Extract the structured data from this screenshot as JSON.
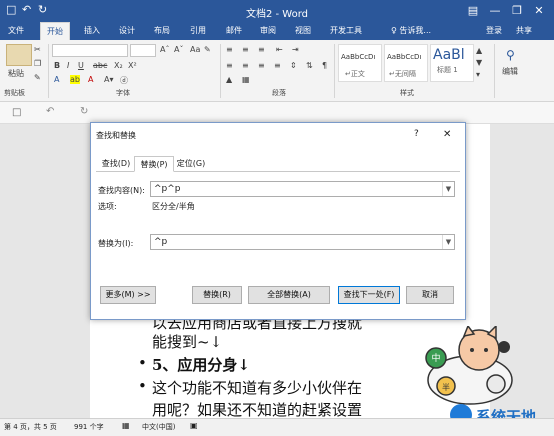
{
  "window": {
    "title": "文档2 - Word",
    "min_icon": "minimize-icon",
    "restore_icon": "restore-icon",
    "close_icon": "close-icon",
    "options_icon": "ribbon-options-icon"
  },
  "ribbon_tabs": [
    "文件",
    "开始",
    "插入",
    "设计",
    "布局",
    "引用",
    "邮件",
    "审阅",
    "视图",
    "开发工具"
  ],
  "tell_me": "♀ 告诉我...",
  "account": {
    "login": "登录",
    "share": "共享"
  },
  "ribbon": {
    "paste": "粘贴",
    "clipboard": "剪贴板",
    "font": "字体",
    "paragraph": "段落",
    "styles": "样式",
    "edit": "编辑",
    "styles_list": [
      {
        "preview": "AaBbCcDı",
        "name": "↵正文"
      },
      {
        "preview": "AaBbCcDı",
        "name": "↵无间隔"
      },
      {
        "preview": "AaBl",
        "name": "标题 1"
      }
    ]
  },
  "dialog": {
    "title": "查找和替换",
    "help": "?",
    "close": "✕",
    "tabs": [
      "查找(D)",
      "替换(P)",
      "定位(G)"
    ],
    "find_label": "查找内容(N):",
    "find_value": "^p^p",
    "options_label": "选项:",
    "options_value": "区分全/半角",
    "replace_label": "替换为(I):",
    "replace_value": "^p",
    "buttons": {
      "more": "更多(M) >>",
      "replace": "替换(R)",
      "replace_all": "全部替换(A)",
      "find_next": "查找下一处(F)",
      "cancel": "取消"
    }
  },
  "document": {
    "line1": "以去应用商店或者直接上方搜就",
    "line2": "能搜到~↓",
    "bullet1": "5、应用分身↓",
    "line3": "这个功能不知道有多少小伙伴在",
    "line4": "用呢？如果还不知道的赶紧设置"
  },
  "status": {
    "page": "第 4 页，共 5 页",
    "words": "991 个字",
    "language": "中文(中国)"
  },
  "watermark": {
    "text": "系统天地"
  }
}
